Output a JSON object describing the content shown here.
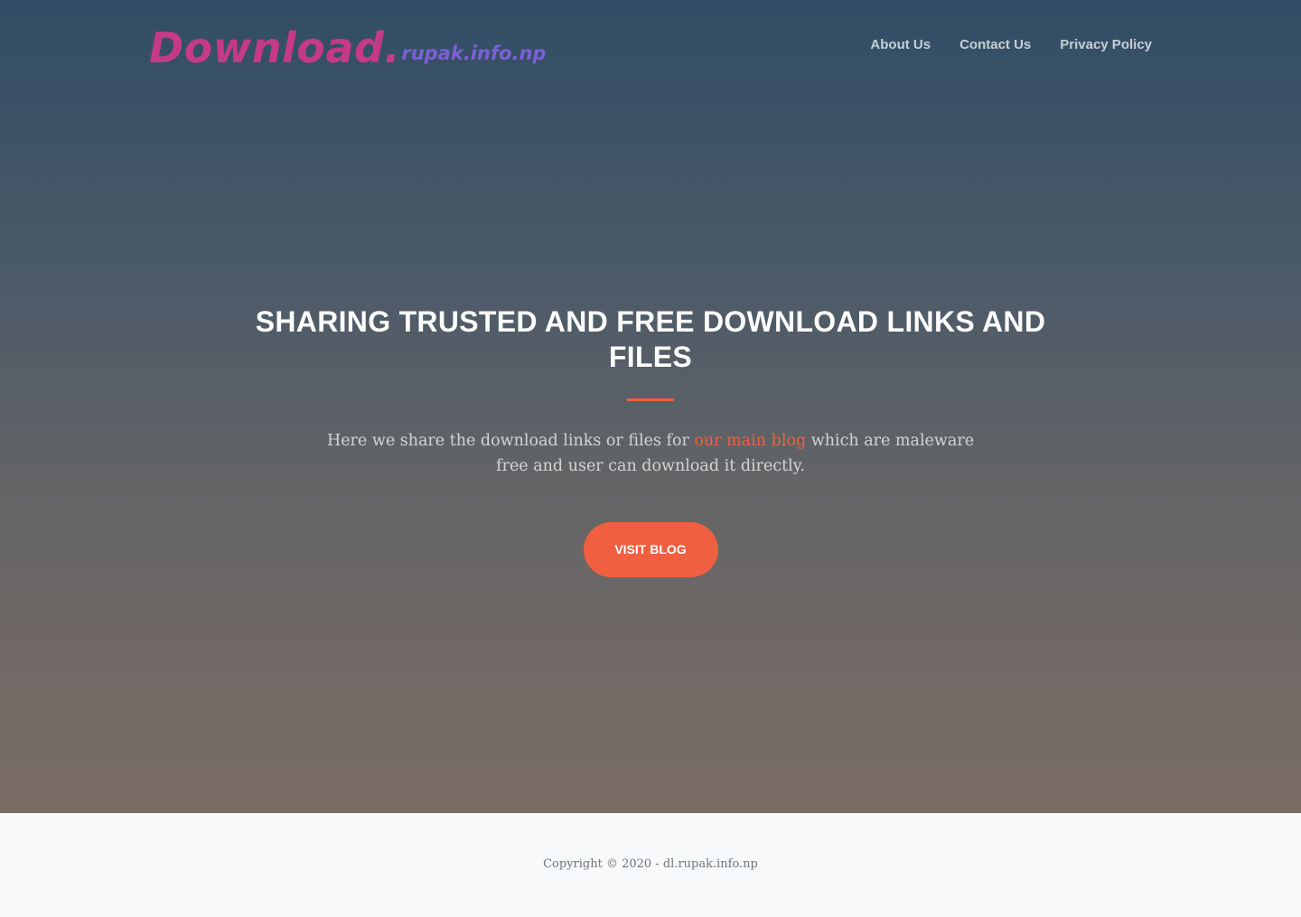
{
  "logo": {
    "main": "Download.",
    "sub": "rupak.info.np"
  },
  "nav": {
    "items": [
      {
        "label": "About Us"
      },
      {
        "label": "Contact Us"
      },
      {
        "label": "Privacy Policy"
      }
    ]
  },
  "hero": {
    "title": "SHARING TRUSTED AND FREE DOWNLOAD LINKS AND FILES",
    "text_before": "Here we share the download links or files for ",
    "link_text": "our main blog",
    "text_after": " which are maleware free and user can download it directly.",
    "button_label": "VISIT BLOG"
  },
  "footer": {
    "copyright": "Copyright © 2020 - dl.rupak.info.np"
  },
  "colors": {
    "accent": "#f05f40",
    "logo_main": "#c43a86",
    "logo_sub": "#7d5fd8",
    "footer_bg": "#f8f9fa"
  }
}
